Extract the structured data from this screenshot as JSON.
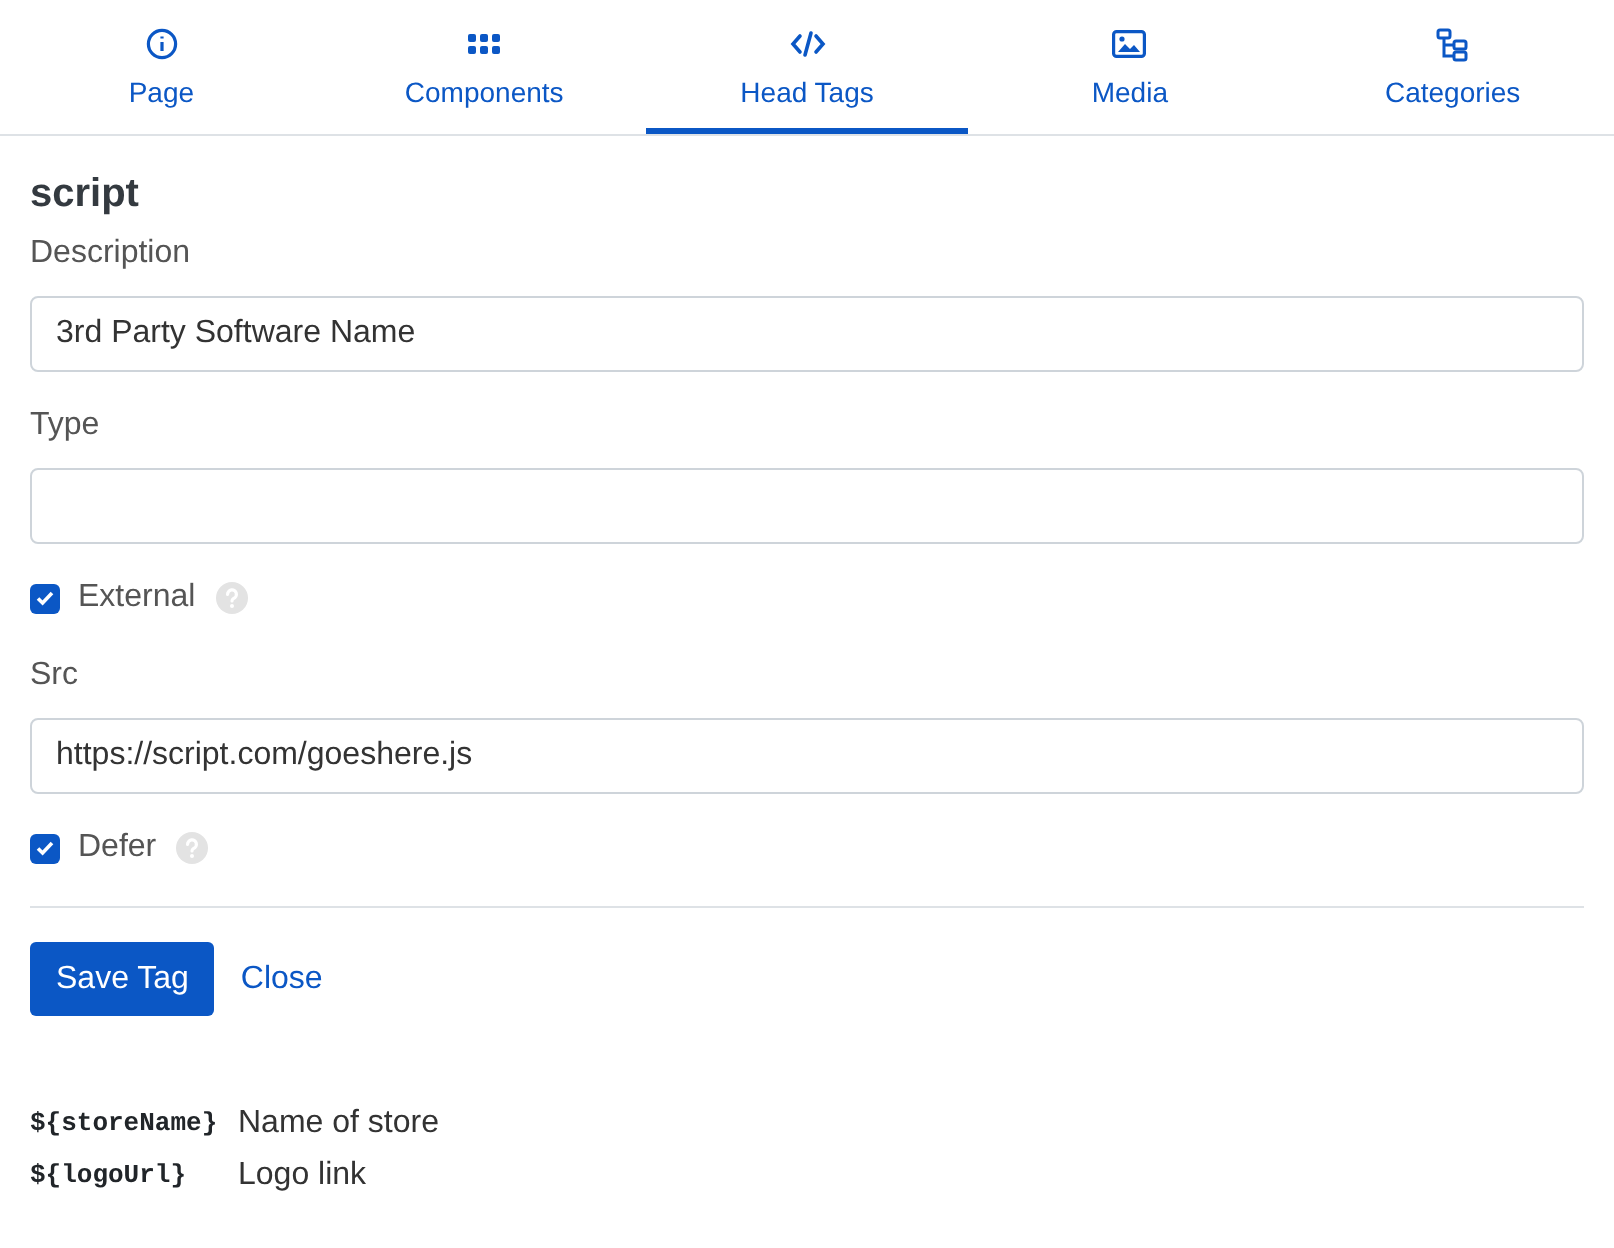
{
  "tabs": [
    {
      "label": "Page",
      "kind": "info",
      "selected": false
    },
    {
      "label": "Components",
      "kind": "grid",
      "selected": false
    },
    {
      "label": "Head Tags",
      "kind": "code",
      "selected": true
    },
    {
      "label": "Media",
      "kind": "image",
      "selected": false
    },
    {
      "label": "Categories",
      "kind": "tree",
      "selected": false
    }
  ],
  "form": {
    "title": "script",
    "fields": [
      {
        "kind": "text",
        "label": "Description",
        "value": "3rd Party Software Name"
      },
      {
        "kind": "text",
        "label": "Type"
      },
      {
        "kind": "checkbox",
        "label": "External",
        "checked": true,
        "help": true
      },
      {
        "kind": "text",
        "label": "Src",
        "value": "https://script.com/goeshere.js"
      },
      {
        "kind": "checkbox",
        "label": "Defer",
        "checked": true,
        "help": true
      }
    ],
    "buttons": [
      "Save Tag",
      "Close"
    ]
  },
  "variables": [
    {
      "name": "${storeName}",
      "description": "Name of store"
    },
    {
      "name": "${logoUrl}",
      "description": "Logo link"
    }
  ]
}
